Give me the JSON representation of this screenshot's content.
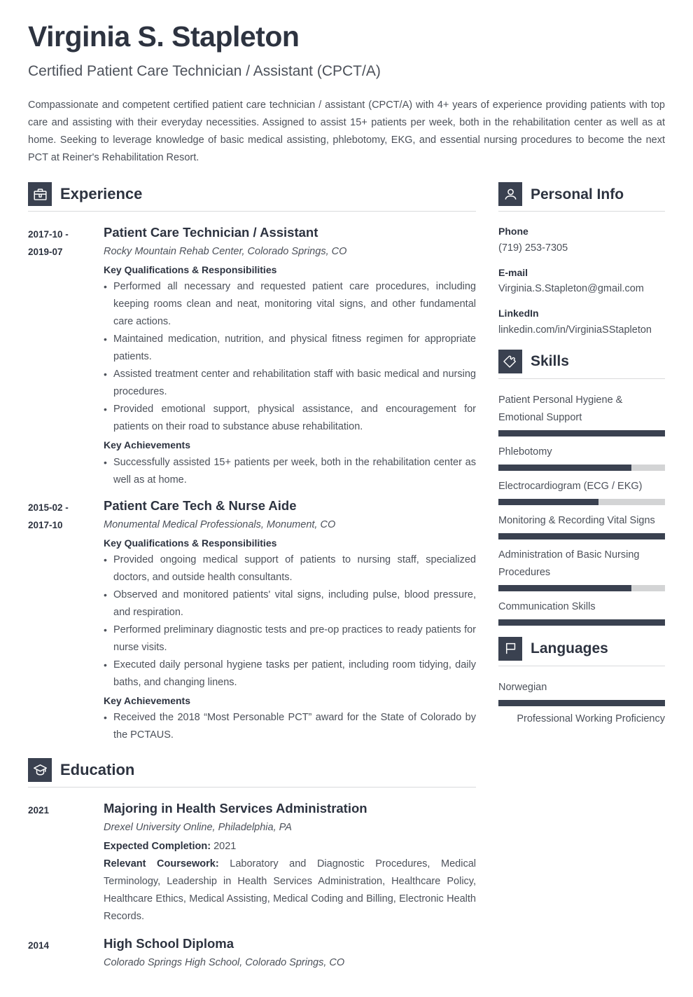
{
  "header": {
    "name": "Virginia S. Stapleton",
    "job_title": "Certified Patient Care Technician / Assistant (CPCT/A)",
    "summary": "Compassionate and competent certified patient care technician / assistant (CPCT/A) with 4+ years of experience providing patients with top care and assisting with their everyday necessities. Assigned to assist 15+ patients per week, both in the rehabilitation center as well as at home. Seeking to leverage knowledge of basic medical assisting, phlebotomy, EKG, and essential nursing procedures to become the next PCT at Reiner's Rehabilitation Resort."
  },
  "colors": {
    "accent_dark": "#3a4150",
    "heading": "#2d3340",
    "body_text": "#4c515a",
    "bar_track": "#d3d4d5",
    "divider": "#d9dadc"
  },
  "experience": {
    "section_title": "Experience",
    "icon": "briefcase-icon",
    "entries": [
      {
        "date": "2017-10 - 2019-07",
        "date_line1": "2017-10 -",
        "date_line2": "2019-07",
        "role": "Patient Care Technician / Assistant",
        "organization": "Rocky Mountain Rehab Center, Colorado Springs, CO",
        "qualifications_heading": "Key Qualifications & Responsibilities",
        "qualifications": [
          "Performed all necessary and requested patient care procedures, including keeping rooms clean and neat, monitoring vital signs, and other fundamental care actions.",
          "Maintained medication, nutrition, and physical fitness regimen for appropriate patients.",
          "Assisted treatment center and rehabilitation staff with basic medical and nursing procedures.",
          "Provided emotional support, physical assistance, and encouragement for patients on their road to substance abuse rehabilitation."
        ],
        "achievements_heading": "Key Achievements",
        "achievements": [
          "Successfully assisted 15+ patients per week, both in the rehabilitation center as well as at home."
        ]
      },
      {
        "date": "2015-02 - 2017-10",
        "date_line1": "2015-02 -",
        "date_line2": "2017-10",
        "role": "Patient Care Tech & Nurse Aide",
        "organization": "Monumental Medical Professionals, Monument, CO",
        "qualifications_heading": "Key Qualifications & Responsibilities",
        "qualifications": [
          "Provided ongoing medical support of patients to nursing staff, specialized doctors, and outside health consultants.",
          "Observed and monitored patients' vital signs, including pulse, blood pressure, and respiration.",
          "Performed preliminary diagnostic tests and pre-op practices to ready patients for nurse visits.",
          "Executed daily personal hygiene tasks per patient, including room tidying, daily baths, and changing linens."
        ],
        "achievements_heading": "Key Achievements",
        "achievements": [
          "Received the 2018 “Most Personable PCT” award for the State of Colorado by the PCTAUS."
        ]
      }
    ]
  },
  "education": {
    "section_title": "Education",
    "icon": "graduation-cap-icon",
    "entries": [
      {
        "date": "2021",
        "degree": "Majoring in Health Services Administration",
        "school": "Drexel University Online, Philadelphia, PA",
        "completion_label": "Expected Completion:",
        "completion_value": "2021",
        "coursework_label": "Relevant Coursework:",
        "coursework_value": "Laboratory and Diagnostic Procedures, Medical Terminology, Leadership in Health Services Administration, Healthcare Policy, Healthcare Ethics, Medical Assisting, Medical Coding and Billing, Electronic Health Records."
      },
      {
        "date": "2014",
        "degree": "High School Diploma",
        "school": "Colorado Springs High School, Colorado Springs, CO",
        "completion_label": "",
        "completion_value": "",
        "coursework_label": "",
        "coursework_value": ""
      }
    ]
  },
  "personal_info": {
    "section_title": "Personal Info",
    "icon": "person-icon",
    "items": [
      {
        "label": "Phone",
        "value": "(719) 253-7305"
      },
      {
        "label": "E-mail",
        "value": "Virginia.S.Stapleton@gmail.com"
      },
      {
        "label": "LinkedIn",
        "value": "linkedin.com/in/VirginiaSStapleton"
      }
    ]
  },
  "skills": {
    "section_title": "Skills",
    "icon": "puzzle-piece-icon",
    "items": [
      {
        "label": "Patient Personal Hygiene & Emotional Support",
        "level": 100
      },
      {
        "label": "Phlebotomy",
        "level": 80
      },
      {
        "label": "Electrocardiogram (ECG / EKG)",
        "level": 60
      },
      {
        "label": "Monitoring & Recording Vital Signs",
        "level": 100
      },
      {
        "label": "Administration of Basic Nursing Procedures",
        "level": 80
      },
      {
        "label": "Communication Skills",
        "level": 100
      }
    ]
  },
  "languages": {
    "section_title": "Languages",
    "icon": "flag-icon",
    "items": [
      {
        "name": "Norwegian",
        "level": 100,
        "proficiency": "Professional Working Proficiency"
      }
    ]
  }
}
